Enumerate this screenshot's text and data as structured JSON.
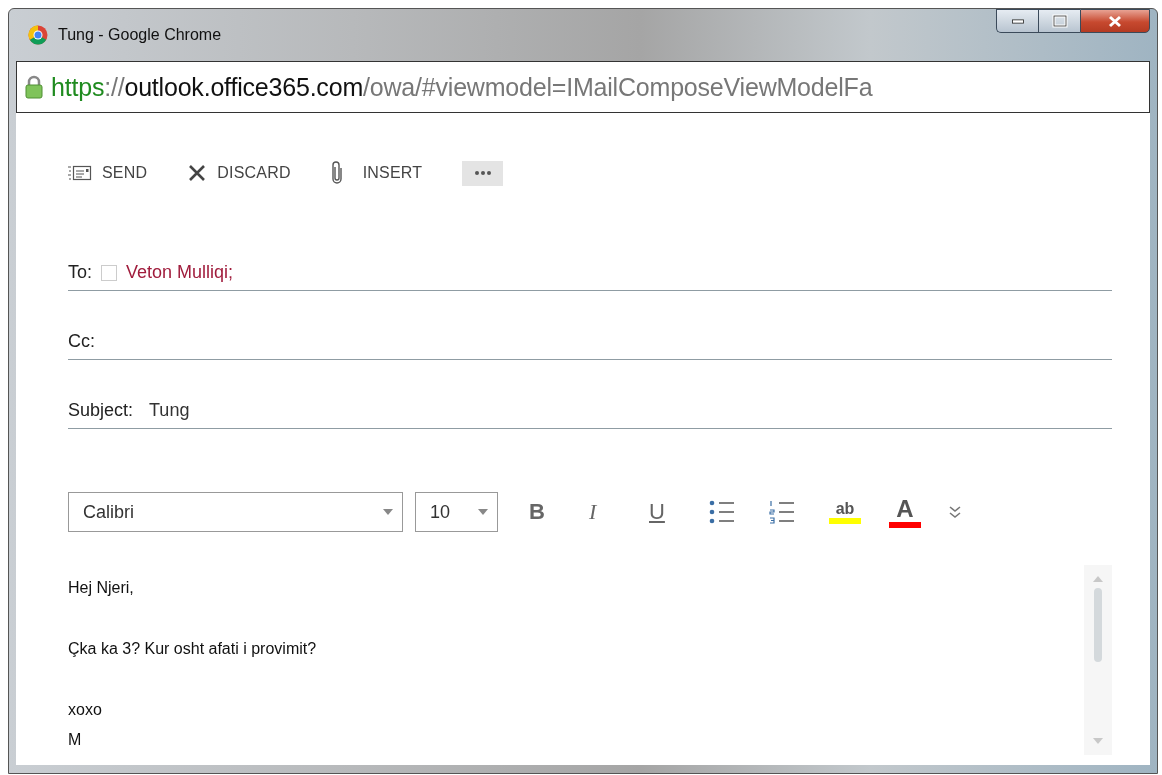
{
  "window": {
    "title": "Tung - Google Chrome",
    "controls": [
      {
        "kind": "minimize"
      },
      {
        "kind": "maximize"
      },
      {
        "kind": "close"
      }
    ]
  },
  "address_bar": {
    "secure": true,
    "scheme": "https",
    "separator": "://",
    "host": "outlook.office365.com",
    "path": "/owa/#viewmodel=IMailComposeViewModelFa"
  },
  "toolbar": [
    {
      "kind": "send",
      "label": "SEND"
    },
    {
      "kind": "discard",
      "label": "DISCARD"
    },
    {
      "kind": "insert",
      "label": "INSERT"
    },
    {
      "kind": "more"
    }
  ],
  "fields": [
    {
      "label": "To:",
      "recipients": [
        "Veton Mulliqi;"
      ]
    },
    {
      "label": "Cc:"
    },
    {
      "label": "Subject:",
      "value": "Tung"
    }
  ],
  "format_bar": {
    "font": "Calibri",
    "size": "10",
    "tools": [
      {
        "kind": "bold",
        "label": "B"
      },
      {
        "kind": "italic",
        "label": "I"
      },
      {
        "kind": "underline",
        "label": "U"
      },
      {
        "kind": "bullets"
      },
      {
        "kind": "numbering"
      },
      {
        "kind": "highlight",
        "label": "ab",
        "color": "#ffff00"
      },
      {
        "kind": "font_color",
        "label": "A",
        "color": "#ff0000"
      },
      {
        "kind": "expand"
      }
    ]
  },
  "body": [
    [
      "Hej Njeri,"
    ],
    [
      "Çka ka 3? Kur osht afati i provimit?"
    ],
    [
      "xoxo",
      "M"
    ]
  ]
}
